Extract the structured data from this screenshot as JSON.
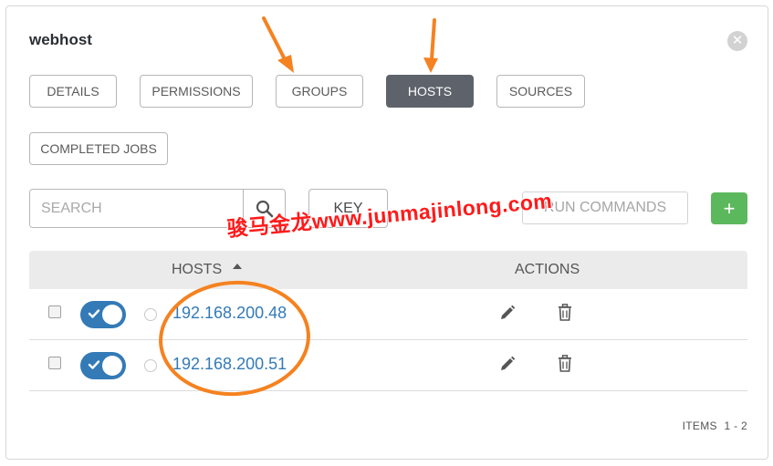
{
  "dialog": {
    "title": "webhost",
    "close_glyph": "✕"
  },
  "tabs": [
    {
      "label": "DETAILS",
      "active": false
    },
    {
      "label": "PERMISSIONS",
      "active": false
    },
    {
      "label": "GROUPS",
      "active": false
    },
    {
      "label": "HOSTS",
      "active": true
    },
    {
      "label": "SOURCES",
      "active": false
    },
    {
      "label": "COMPLETED JOBS",
      "active": false
    }
  ],
  "toolbar": {
    "search_placeholder": "SEARCH",
    "search_icon": "magnifier-icon",
    "key_label": "KEY",
    "run_commands_label": "RUN COMMANDS",
    "add_label": "+"
  },
  "table": {
    "columns": {
      "hosts": "HOSTS",
      "actions": "ACTIONS"
    },
    "sort": "ascending",
    "rows": [
      {
        "host": "192.168.200.48",
        "enabled": true
      },
      {
        "host": "192.168.200.51",
        "enabled": true
      }
    ]
  },
  "pagination": {
    "label": "ITEMS",
    "range": "1 - 2"
  },
  "watermark": {
    "text": "骏马金龙www.junmajinlong.com"
  },
  "colors": {
    "active_tab": "#5e636b",
    "link": "#337ab7",
    "toggle_on": "#337ab7",
    "add_button": "#5cb85c",
    "annotation": "#f58220",
    "watermark": "#ff1a1a"
  }
}
